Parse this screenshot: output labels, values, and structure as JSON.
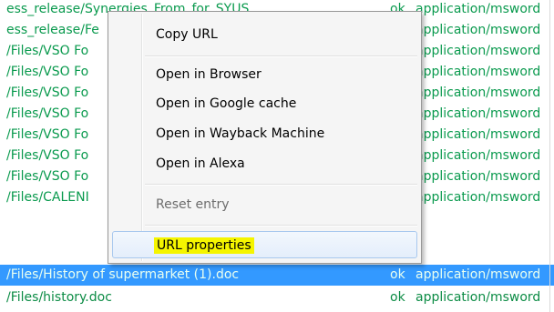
{
  "rows": [
    {
      "url": "ess_release/Synergies_From_for_SYUS",
      "status": "ok",
      "mime": "application/msword"
    },
    {
      "url": "ess_release/Fe",
      "status": "",
      "mime": "application/msword"
    },
    {
      "url": "/Files/VSO Fo",
      "status": "",
      "mime": "application/msword"
    },
    {
      "url": "/Files/VSO Fo",
      "status": "",
      "mime": "application/msword"
    },
    {
      "url": "/Files/VSO Fo",
      "status": "",
      "mime": "application/msword"
    },
    {
      "url": "/Files/VSO Fo",
      "status": "",
      "mime": "application/msword"
    },
    {
      "url": "/Files/VSO Fo",
      "status": "",
      "mime": "application/msword"
    },
    {
      "url": "/Files/VSO Fo",
      "status": "",
      "mime": "application/msword"
    },
    {
      "url": "/Files/VSO Fo",
      "status": "",
      "mime": "application/msword"
    },
    {
      "url": "/Files/CALENI",
      "status": "",
      "mime": "application/msword"
    },
    {
      "url": "/Files/History of supermarket (1).doc",
      "status": "ok",
      "mime": "application/msword"
    },
    {
      "url": "/Files/history.doc",
      "status": "ok",
      "mime": "application/msword"
    }
  ],
  "menu": {
    "copy_url": "Copy URL",
    "open_browser": "Open in Browser",
    "open_google_cache": "Open in Google cache",
    "open_wayback": "Open in Wayback Machine",
    "open_alexa": "Open in Alexa",
    "reset_entry": "Reset entry",
    "url_properties": "URL properties"
  },
  "colors": {
    "link_green": "#0a9a4e",
    "selection_blue": "#3399ff",
    "highlight_yellow": "#f5f500"
  }
}
